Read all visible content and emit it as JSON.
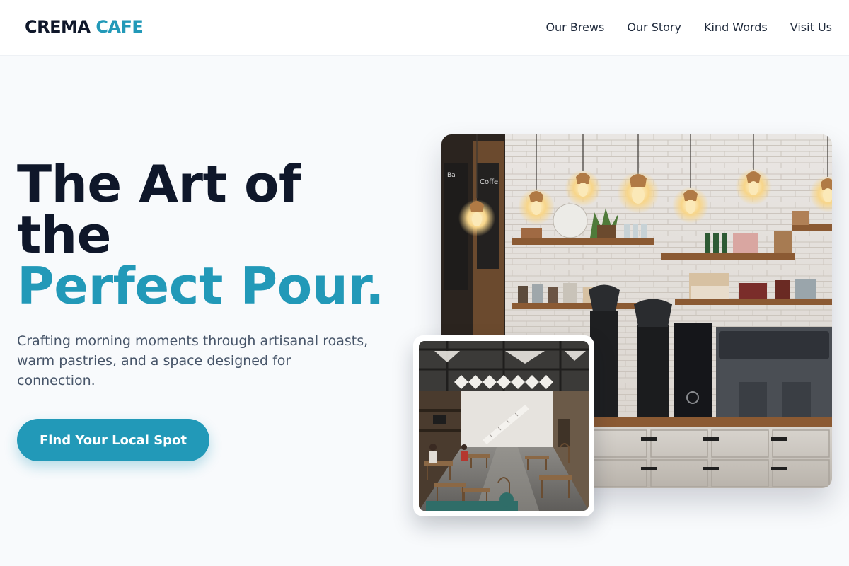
{
  "brand": {
    "name_part1": "CREMA",
    "name_part2": "CAFE"
  },
  "nav": {
    "links": [
      {
        "label": "Our Brews"
      },
      {
        "label": "Our Story"
      },
      {
        "label": "Kind Words"
      },
      {
        "label": "Visit Us"
      }
    ]
  },
  "hero": {
    "title_line1": "The Art of",
    "title_line2": "the",
    "title_line3": "Perfect Pour.",
    "subtitle": "Crafting morning moments through artisanal roasts, warm pastries, and a space designed for connection.",
    "cta_label": "Find Your Local Spot"
  },
  "images": {
    "main": "cafe-counter-photo",
    "inset": "cafe-interior-photo"
  },
  "colors": {
    "accent": "#2299b8",
    "heading": "#0f172a",
    "body_text": "#475569",
    "background": "#f8fafc"
  }
}
